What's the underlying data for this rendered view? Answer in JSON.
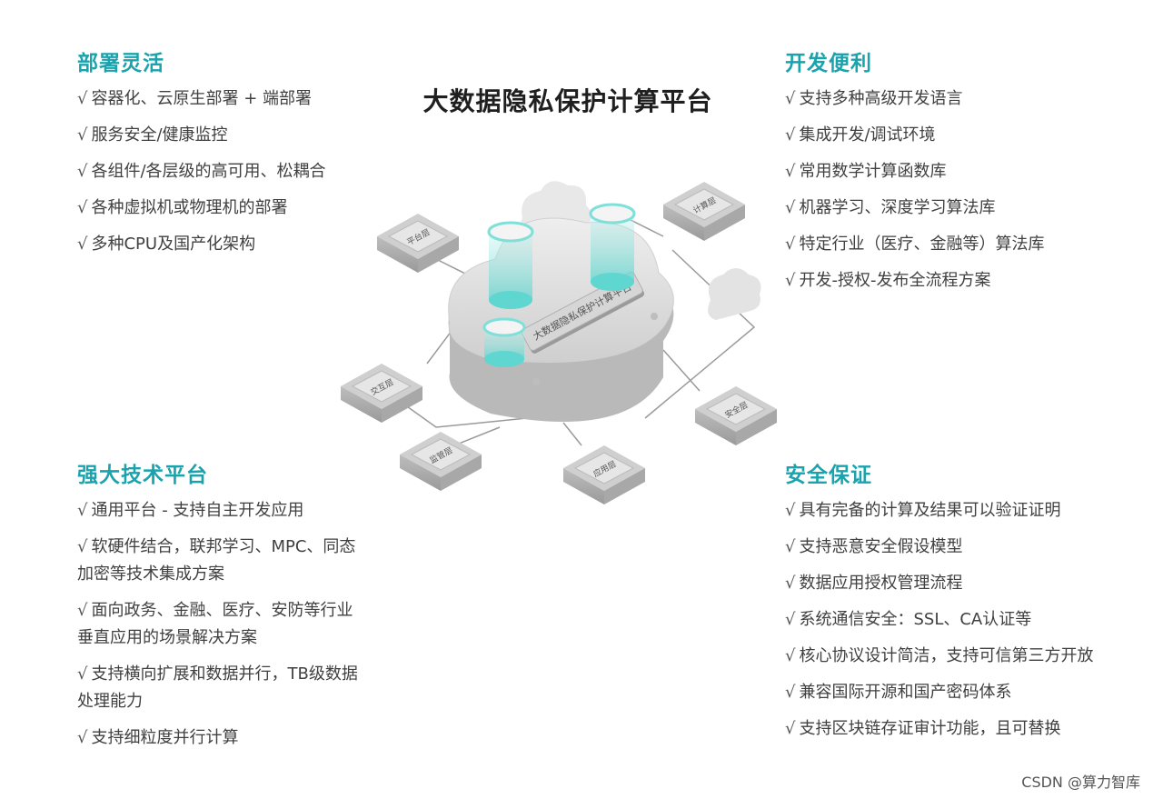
{
  "title": "大数据隐私保护计算平台",
  "check": "√",
  "sections": {
    "deploy": {
      "title": "部署灵活",
      "items": [
        "容器化、云原生部署 + 端部署",
        "服务安全/健康监控",
        "各组件/各层级的高可用、松耦合",
        "各种虚拟机或物理机的部署",
        "多种CPU及国产化架构"
      ]
    },
    "dev": {
      "title": "开发便利",
      "items": [
        "支持多种高级开发语言",
        "集成开发/调试环境",
        "常用数学计算函数库",
        "机器学习、深度学习算法库",
        "特定行业（医疗、金融等）算法库",
        "开发-授权-发布全流程方案"
      ]
    },
    "tech": {
      "title": "强大技术平台",
      "items": [
        "通用平台 - 支持自主开发应用",
        "软硬件结合，联邦学习、MPC、同态加密等技术集成方案",
        "面向政务、金融、医疗、安防等行业垂直应用的场景解决方案",
        "支持横向扩展和数据并行，TB级数据处理能力",
        "支持细粒度并行计算"
      ]
    },
    "security": {
      "title": "安全保证",
      "items": [
        "具有完备的计算及结果可以验证证明",
        "支持恶意安全假设模型",
        "数据应用授权管理流程",
        "系统通信安全：SSL、CA认证等",
        "核心协议设计简洁，支持可信第三方开放",
        "兼容国际开源和国产密码体系",
        "支持区块链存证审计功能，且可替换"
      ]
    }
  },
  "chips": {
    "platform": "平台层",
    "compute": "计算层",
    "interaction": "交互层",
    "monitor": "监管层",
    "application": "应用层",
    "security": "安全层"
  },
  "cloud_label": "大数据隐私保护计算平台",
  "watermark": "CSDN @算力智库",
  "colors": {
    "accent": "#1aa3ad",
    "cylinder": "#5fd6cf",
    "chip": "#dcdcdc"
  }
}
